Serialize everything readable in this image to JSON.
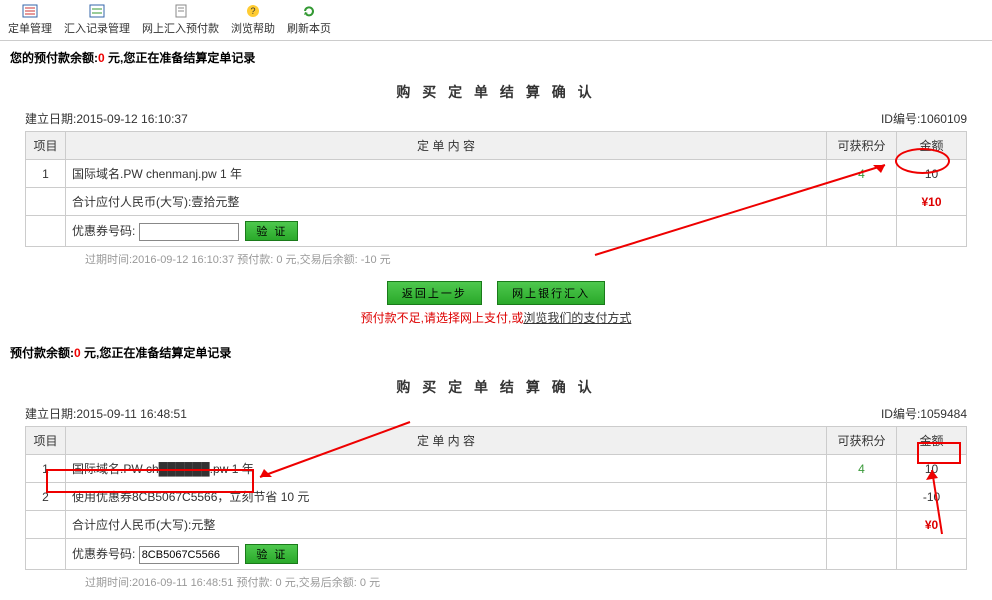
{
  "nav": {
    "items": [
      {
        "label": "定单管理",
        "icon": "list"
      },
      {
        "label": "汇入记录管理",
        "icon": "list2"
      },
      {
        "label": "网上汇入预付款",
        "icon": "doc"
      },
      {
        "label": "浏览帮助",
        "icon": "help"
      },
      {
        "label": "刷新本页",
        "icon": "refresh"
      }
    ]
  },
  "balance1": {
    "prefix": "您的预付款余额:",
    "amount": "0",
    "suffix": " 元,您正在准备结算定单记录"
  },
  "balance2": {
    "prefix": "预付款余额:",
    "amount": "0",
    "suffix": " 元,您正在准备结算定单记录"
  },
  "order1": {
    "title": "购 买 定 单 结 算 确 认",
    "created_label": "建立日期:",
    "created": "2015-09-12 16:10:37",
    "id_label": "ID编号:",
    "id": "1060109",
    "cols": {
      "idx": "项目",
      "content": "定 单 内 容",
      "points": "可获积分",
      "amount": "金额"
    },
    "rows": [
      {
        "idx": "1",
        "content": "国际域名.PW chenmanj.pw 1 年",
        "points": "4",
        "amount": "10"
      }
    ],
    "sum_label": "合计应付人民币(大写):壹拾元整",
    "sum_amount": "¥10",
    "coupon_label": "优惠券号码:",
    "coupon_value": "",
    "verify": "验 证",
    "expired": "过期时间:2016-09-12 16:10:37 预付款: 0 元,交易后余额: -10 元",
    "btn_back": "返回上一步",
    "btn_bank": "网上银行汇入",
    "warning_pre": "预付款不足,请选择网上支付,或",
    "warning_link": "浏览我们的支付方式"
  },
  "order2": {
    "title": "购 买 定 单 结 算 确 认",
    "created_label": "建立日期:",
    "created": "2015-09-11 16:48:51",
    "id_label": "ID编号:",
    "id": "1059484",
    "cols": {
      "idx": "项目",
      "content": "定 单 内 容",
      "points": "可获积分",
      "amount": "金额"
    },
    "rows": [
      {
        "idx": "1",
        "content": "国际域名.PW ch██████.pw 1 年",
        "points": "4",
        "amount": "10"
      },
      {
        "idx": "2",
        "content": "使用优惠券8CB5067C5566，立刻节省 10 元",
        "points": "",
        "amount": "-10"
      }
    ],
    "sum_label": "合计应付人民币(大写):元整",
    "sum_amount": "¥0",
    "coupon_label": "优惠券号码:",
    "coupon_value": "8CB5067C5566",
    "verify": "验 证",
    "expired": "过期时间:2016-09-11 16:48:51 预付款: 0 元,交易后余额: 0 元"
  }
}
